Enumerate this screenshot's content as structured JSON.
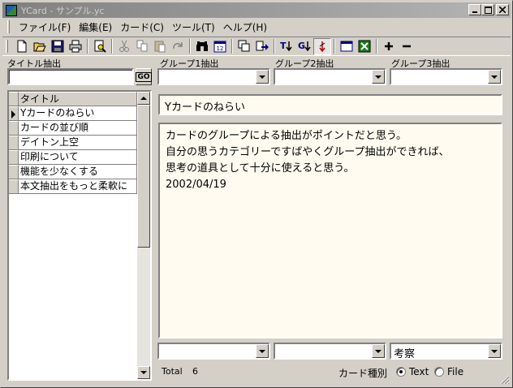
{
  "window": {
    "title": "YCard - サンプル.yc"
  },
  "menu": [
    "ファイル(F)",
    "編集(E)",
    "カード(C)",
    "ツール(T)",
    "ヘルプ(H)"
  ],
  "filters": {
    "title_label": "タイトル抽出",
    "title_value": "",
    "go_label": "GO",
    "group1_label": "グループ1抽出",
    "group2_label": "グループ2抽出",
    "group3_label": "グループ3抽出",
    "group1_value": "",
    "group2_value": "",
    "group3_value": ""
  },
  "grid": {
    "header": "タイトル",
    "rows": [
      "Yカードのねらい",
      "カードの並び順",
      "デイトン上空",
      "印刷について",
      "機能を少なくする",
      "本文抽出をもっと柔軟に"
    ],
    "selected_index": 0
  },
  "card": {
    "title": "Yカードのねらい",
    "body_lines": [
      "カードのグループによる抽出がポイントだと思う。",
      "自分の思うカテゴリーですばやくグループ抽出ができれば、",
      "思考の道具として十分に使えると思う。",
      "2002/04/19"
    ],
    "group1": "",
    "group2": "",
    "group3": "考察"
  },
  "status": {
    "total_label": "Total",
    "total_count": "6",
    "kind_label": "カード種別",
    "kind_options": [
      "Text",
      "File"
    ],
    "kind_selected": "Text"
  },
  "toolbar_icons": [
    "new-icon",
    "open-icon",
    "save-icon",
    "print-icon",
    "print-preview-icon",
    "cut-icon",
    "copy-icon",
    "paste-icon",
    "redo-icon",
    "find-icon",
    "calendar-icon",
    "duplicate-icon",
    "export-icon",
    "sort-title-icon",
    "sort-group-icon",
    "sort-toggle-icon",
    "window-icon",
    "excel-icon",
    "add-icon",
    "remove-icon"
  ]
}
